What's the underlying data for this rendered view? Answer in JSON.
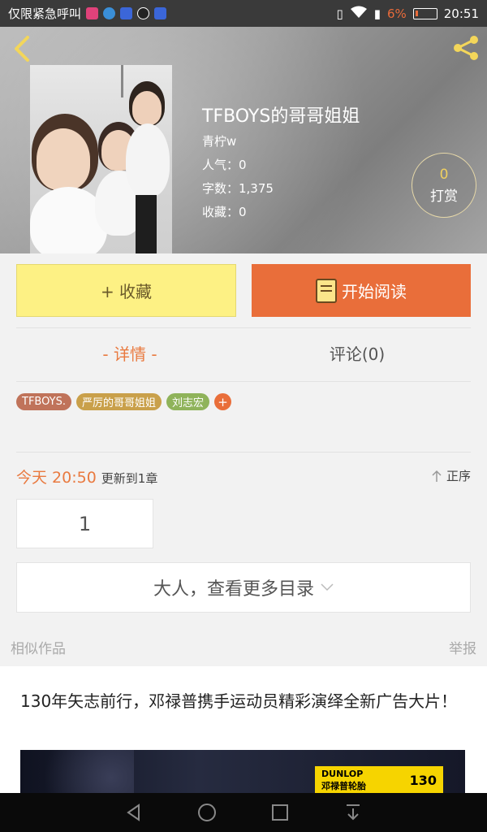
{
  "status_bar": {
    "carrier": "仅限紧急呼叫",
    "battery_percent": "6%",
    "time": "20:51"
  },
  "book": {
    "title": "TFBOYS的哥哥姐姐",
    "author": "青柠w",
    "popularity": "人气：0",
    "word_count": "字数：1,375",
    "favorites": "收藏：0"
  },
  "reward": {
    "count": "0",
    "label": "打赏"
  },
  "actions": {
    "collect_label": "+ 收藏",
    "read_label": "开始阅读"
  },
  "tabs": {
    "details": "- 详情 -",
    "comments": "评论(0)"
  },
  "tags": [
    {
      "label": "TFBOYS.",
      "color": "#c0735a"
    },
    {
      "label": "严厉的哥哥姐姐",
      "color": "#c9a04a"
    },
    {
      "label": "刘志宏",
      "color": "#8fb35a"
    }
  ],
  "tag_add": "+",
  "update": {
    "time": "今天 20:50",
    "desc": "更新到1章",
    "sort_label": "正序"
  },
  "chapter_number": "1",
  "more_catalog": "大人，查看更多目录",
  "similar_works": "相似作品",
  "report": "举报",
  "ad": {
    "text": "130年矢志前行，邓禄普携手运动员精彩演绎全新广告大片！",
    "brand": "DUNLOP",
    "brand_cn": "邓禄普轮胎",
    "brand_mark": "130"
  },
  "colors": {
    "accent": "#e96e3a",
    "collect_bg": "#fdf184"
  }
}
